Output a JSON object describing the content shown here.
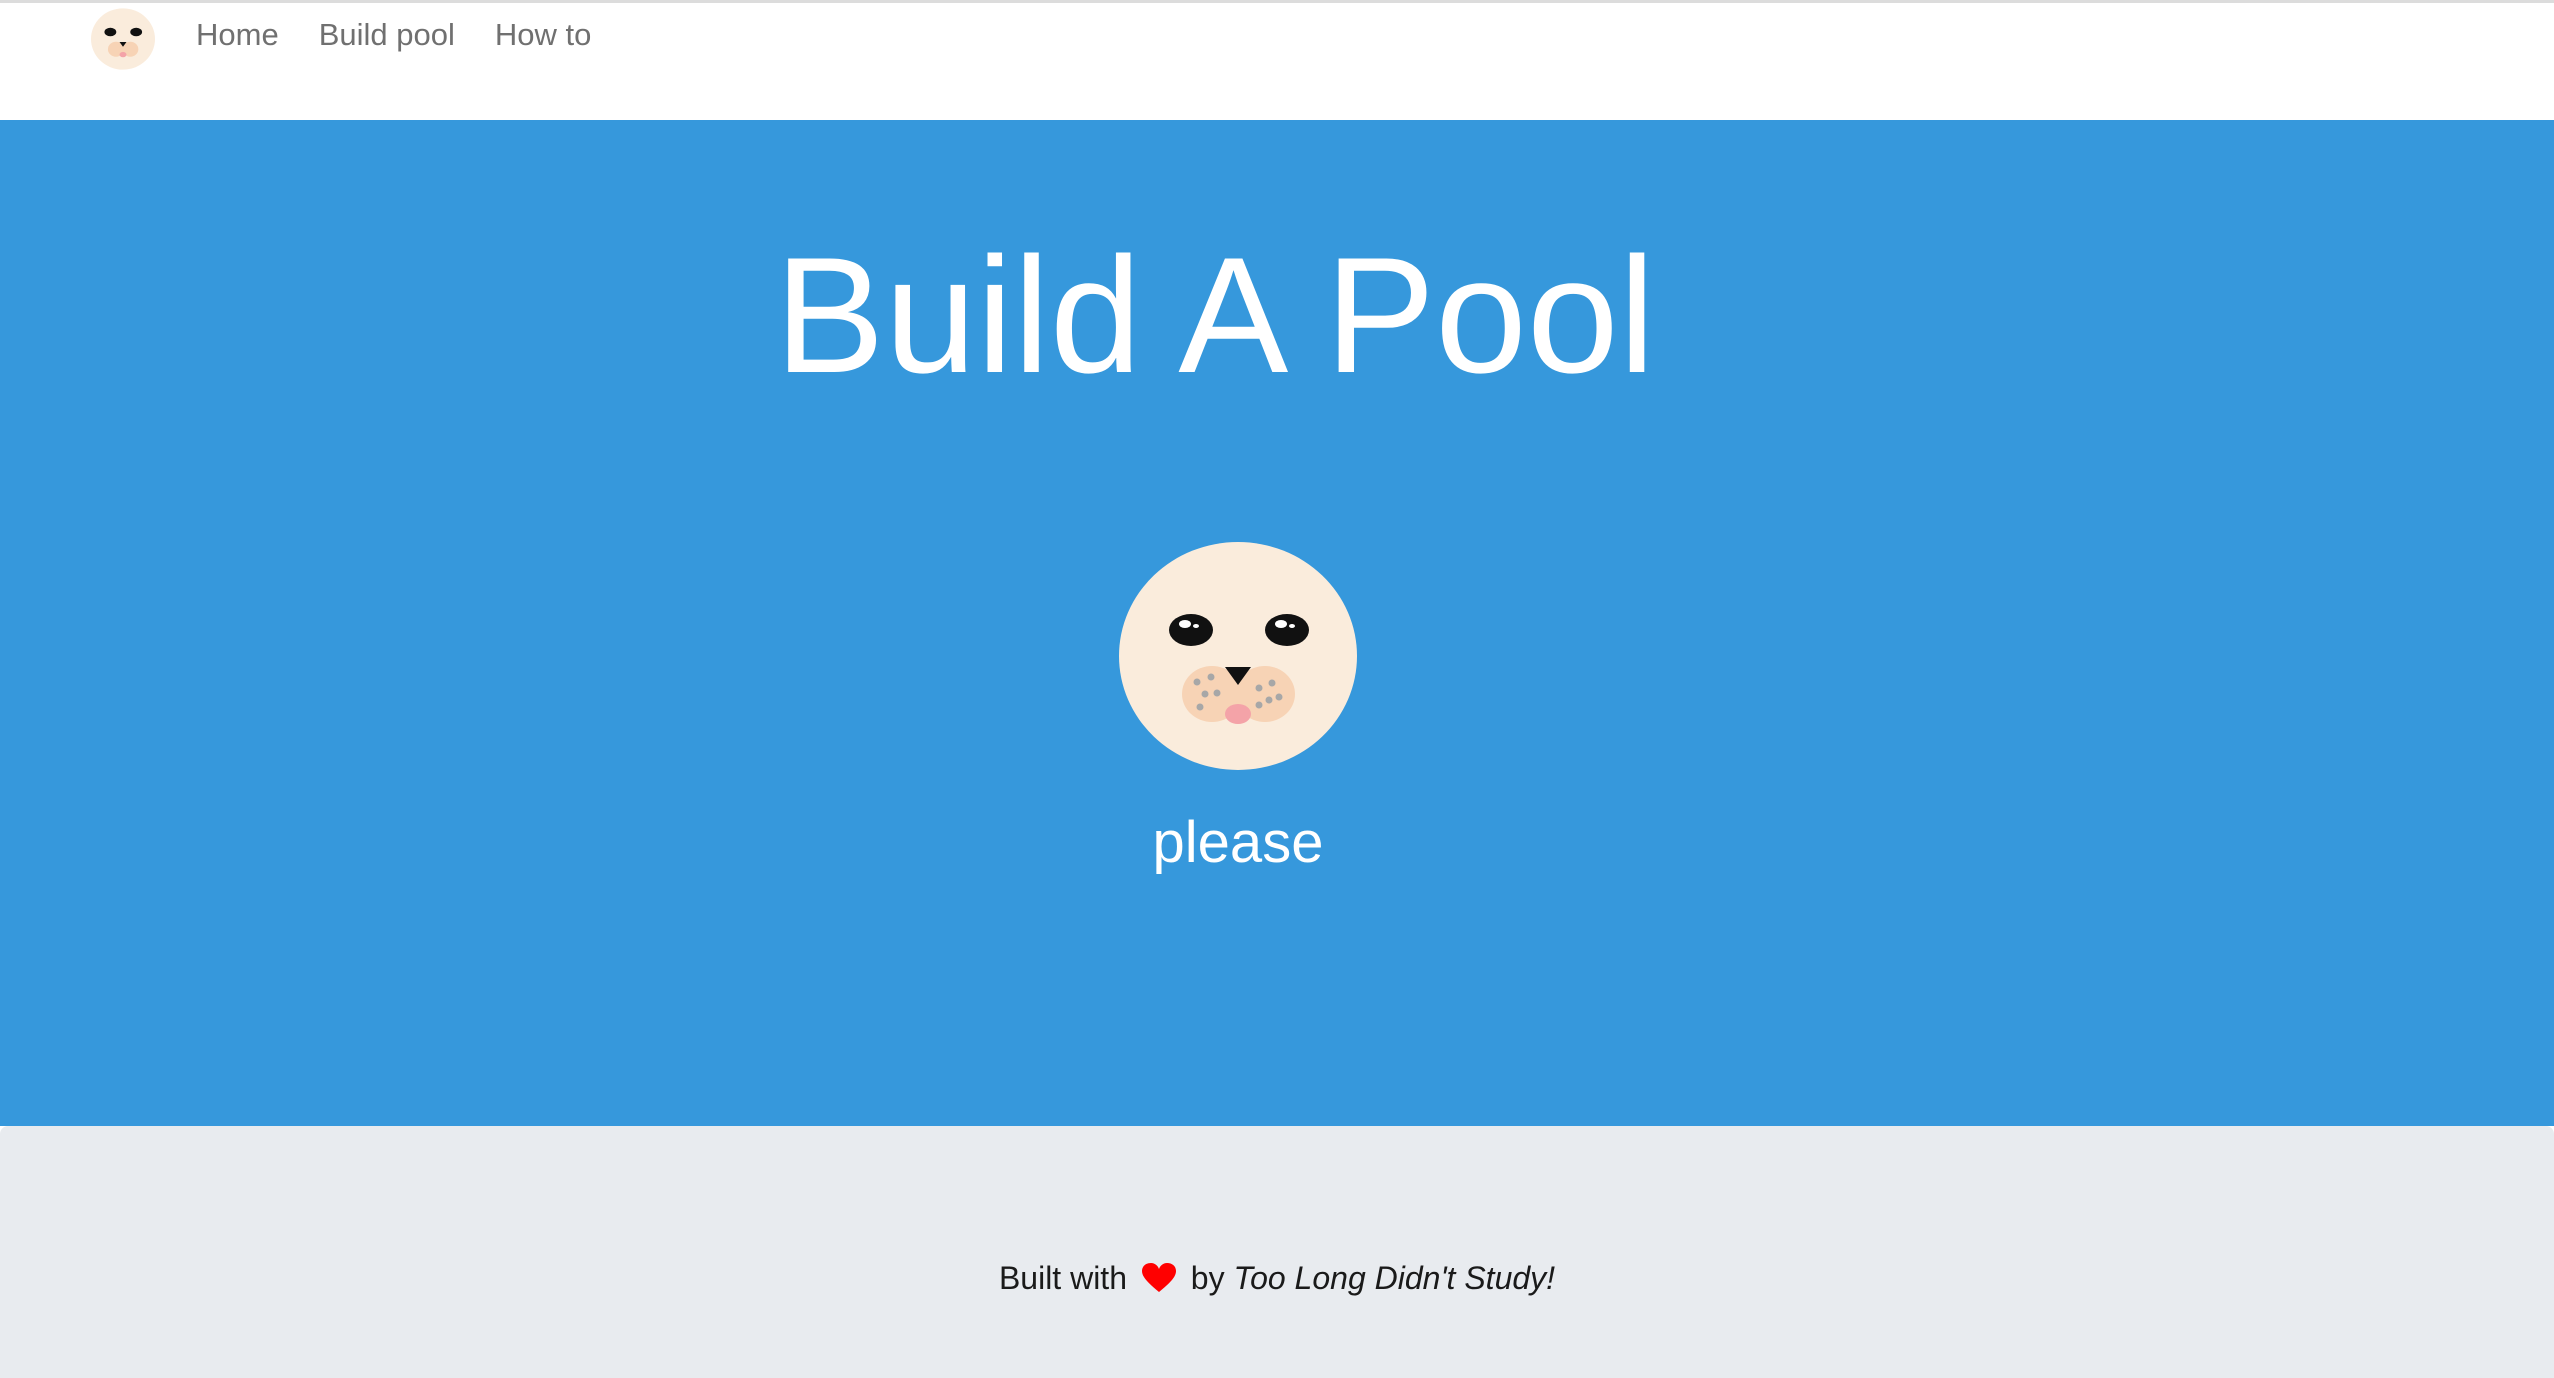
{
  "nav": {
    "logo_icon": "seal-face-icon",
    "items": [
      {
        "label": "Home"
      },
      {
        "label": "Build pool"
      },
      {
        "label": "How to"
      }
    ]
  },
  "hero": {
    "title": "Build A Pool",
    "mascot_icon": "seal-face-icon",
    "subtitle": "please"
  },
  "footer": {
    "prefix": "Built with",
    "heart_icon": "heart-icon",
    "by": "by",
    "team": "Too Long Didn't Study!"
  },
  "colors": {
    "hero_background": "#3698dc",
    "footer_background": "#e8ebef",
    "nav_text": "#707070",
    "heart": "#ff0000",
    "seal_face": "#faecdc"
  }
}
